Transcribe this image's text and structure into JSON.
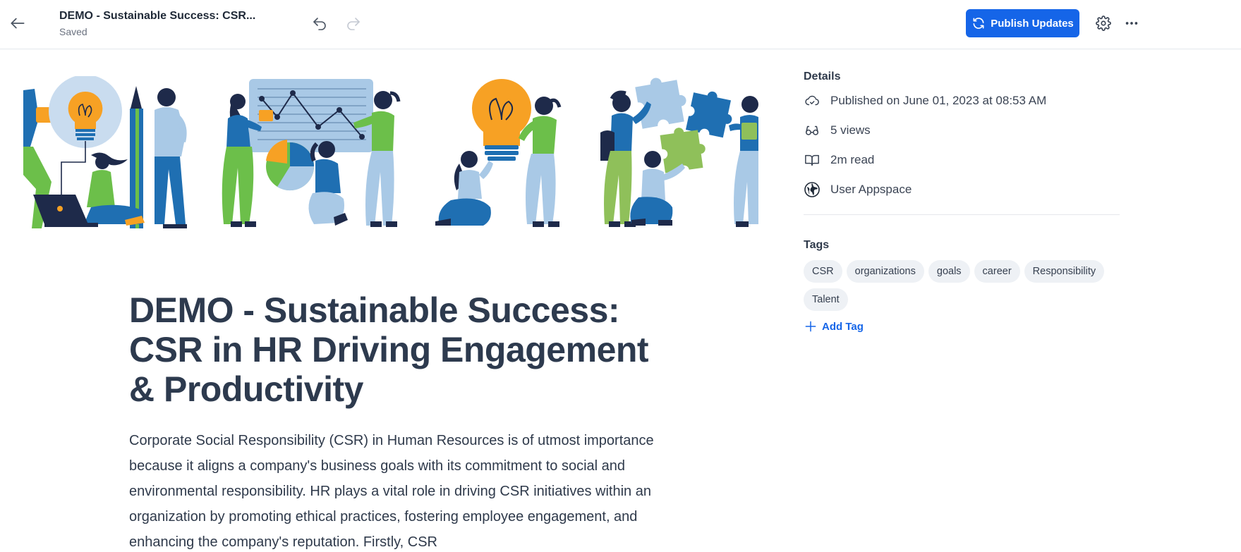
{
  "header": {
    "doc_title": "DEMO - Sustainable Success: CSR...",
    "status": "Saved",
    "publish_label": "Publish Updates",
    "icons": [
      "arrow-left-icon",
      "undo-icon",
      "redo-icon",
      "refresh-icon",
      "gear-icon",
      "more-horizontal-icon"
    ]
  },
  "article": {
    "title": "DEMO - Sustainable Success: CSR in HR Driving Engagement & Productivity",
    "body": "Corporate Social Responsibility (CSR) in Human Resources is of utmost importance because it aligns a company's business goals with its commitment to social and environmental responsibility. HR plays a vital role in driving CSR initiatives within an organization by promoting ethical practices, fostering employee engagement, and enhancing the company's reputation. Firstly, CSR"
  },
  "details": {
    "heading": "Details",
    "published": "Published on June 01, 2023 at 08:53 AM",
    "views": "5 views",
    "read_time": "2m read",
    "space": "User Appspace",
    "icons": [
      "cloud-icon",
      "glasses-icon",
      "book-open-icon",
      "globe-icon"
    ]
  },
  "tags": {
    "heading": "Tags",
    "items": [
      "CSR",
      "organizations",
      "goals",
      "career",
      "Responsibility",
      "Talent"
    ],
    "add_label": "Add Tag"
  },
  "colors": {
    "accent": "#1565e8",
    "text": "#2f3a4b",
    "muted": "#6b7280",
    "tag_bg": "#eef1f5",
    "illustration_orange": "#f7a124",
    "illustration_blue": "#1f6fb2",
    "illustration_light_blue": "#a9c9e6",
    "illustration_green": "#6cbf4a",
    "illustration_navy": "#1e2a4a"
  }
}
